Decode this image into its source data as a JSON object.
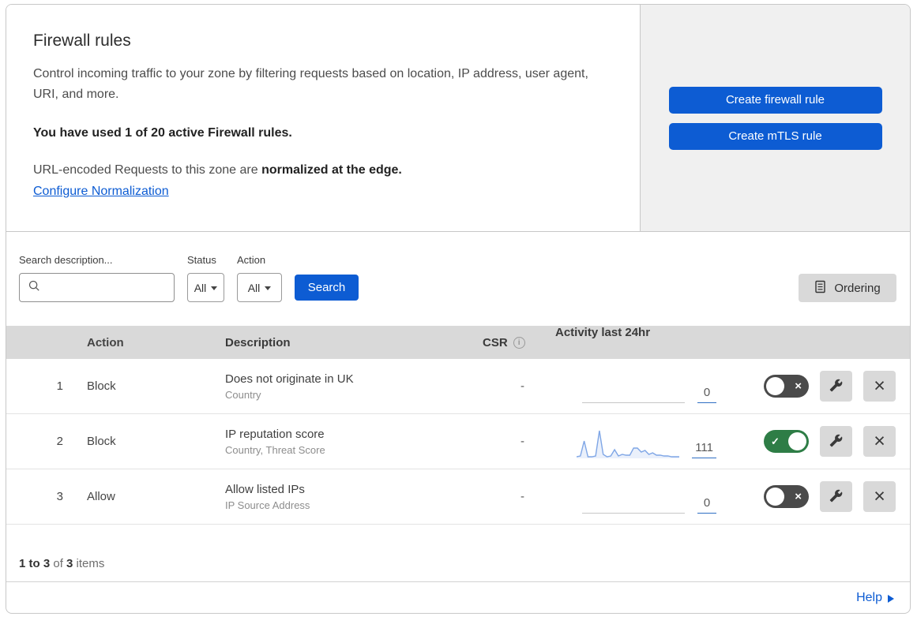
{
  "hero": {
    "title": "Firewall rules",
    "description": "Control incoming traffic to your zone by filtering requests based on location, IP address, user agent, URI, and more.",
    "usage": "You have used 1 of 20 active Firewall rules.",
    "normalization_prefix": "URL-encoded Requests to this zone are ",
    "normalization_bold": "normalized at the edge.",
    "normalization_link": "Configure Normalization",
    "buttons": {
      "create_firewall": "Create firewall rule",
      "create_mtls": "Create mTLS rule"
    }
  },
  "filters": {
    "search_label": "Search description...",
    "search_value": "",
    "status_label": "Status",
    "status_value": "All",
    "action_label": "Action",
    "action_value": "All",
    "search_button": "Search",
    "ordering_button": "Ordering"
  },
  "table": {
    "headers": {
      "action": "Action",
      "description": "Description",
      "csr": "CSR",
      "activity": "Activity last 24hr"
    },
    "rows": [
      {
        "number": "1",
        "action": "Block",
        "description": "Does not originate in UK",
        "expression_fields": "Country",
        "csr": "-",
        "activity_count": "0",
        "enabled": false,
        "sparkline": null
      },
      {
        "number": "2",
        "action": "Block",
        "description": "IP reputation score",
        "expression_fields": "Country, Threat Score",
        "csr": "-",
        "activity_count": "111",
        "enabled": true,
        "sparkline": [
          2,
          3,
          22,
          2,
          2,
          3,
          35,
          5,
          2,
          3,
          11,
          3,
          5,
          4,
          4,
          13,
          13,
          8,
          10,
          5,
          7,
          4,
          4,
          3,
          3,
          2,
          2,
          2
        ]
      },
      {
        "number": "3",
        "action": "Allow",
        "description": "Allow listed IPs",
        "expression_fields": "IP Source Address",
        "csr": "-",
        "activity_count": "0",
        "enabled": false,
        "sparkline": null
      }
    ]
  },
  "footer": {
    "range": "1 to 3",
    "of": " of ",
    "total": "3",
    "items": " items",
    "help": "Help"
  },
  "icons": {
    "close": "×",
    "check": "✓",
    "info": "i"
  },
  "colors": {
    "accent_blue": "#0d5cd3",
    "toggle_on_green": "#2e7d46",
    "toggle_off_gray": "#4a4a4a",
    "sparkline_line": "#7fa6e6",
    "sparkline_fill": "#eaf0fb",
    "table_header_bg": "#d9d9d9"
  }
}
